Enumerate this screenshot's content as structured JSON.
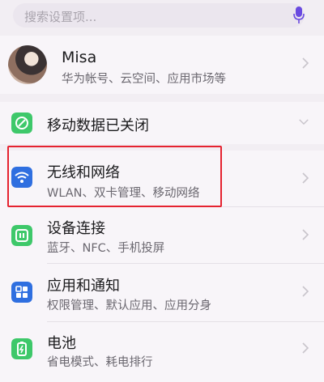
{
  "search": {
    "placeholder": "搜索设置项..."
  },
  "account": {
    "name": "Misa",
    "subtitle": "华为帐号、云空间、应用市场等"
  },
  "mobile_data": {
    "label": "移动数据已关闭"
  },
  "items": [
    {
      "title": "无线和网络",
      "subtitle": "WLAN、双卡管理、移动网络"
    },
    {
      "title": "设备连接",
      "subtitle": "蓝牙、NFC、手机投屏"
    },
    {
      "title": "应用和通知",
      "subtitle": "权限管理、默认应用、应用分身"
    },
    {
      "title": "电池",
      "subtitle": "省电模式、耗电排行"
    }
  ],
  "colors": {
    "wireless_icon": "#2f6fe0",
    "green_icon": "#3ec86a",
    "apps_icon": "#2f6fe0",
    "highlight": "#e52330",
    "mic": "#6a4ae0"
  }
}
